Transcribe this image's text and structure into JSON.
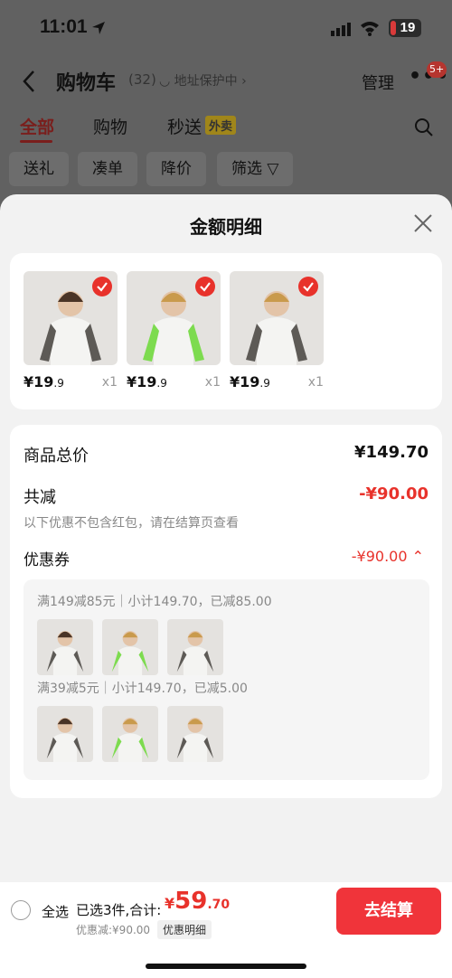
{
  "status_bar": {
    "time": "11:01",
    "battery": "19"
  },
  "nav": {
    "title": "购物车",
    "count": "(32)",
    "address": "◡ 地址保护中 ›",
    "manage": "管理",
    "more": "•••",
    "badge": "5+"
  },
  "tabs": [
    {
      "label": "全部",
      "active": true
    },
    {
      "label": "购物",
      "active": false
    },
    {
      "label": "秒送",
      "tag": "外卖",
      "active": false
    }
  ],
  "chips": [
    "送礼",
    "凑单",
    "降价",
    "筛选 ▽"
  ],
  "sheet": {
    "title": "金额明细",
    "products": [
      {
        "price_main": "¥19",
        "price_dec": ".9",
        "qty": "x1",
        "sleeve_color": "#5d5a56"
      },
      {
        "price_main": "¥19",
        "price_dec": ".9",
        "qty": "x1",
        "sleeve_color": "#7ddb4f"
      },
      {
        "price_main": "¥19",
        "price_dec": ".9",
        "qty": "x1",
        "sleeve_color": "#5d5a56"
      }
    ],
    "summary": {
      "total_label": "商品总价",
      "total_value": "¥149.70",
      "reduce_label": "共减",
      "reduce_value": "-¥90.00",
      "hint": "以下优惠不包含红包，请在结算页查看",
      "coupon_label": "优惠券",
      "coupon_value": "-¥90.00 ⌃"
    },
    "coupons": [
      {
        "text": "满149减85元｜小计149.70，已减85.00"
      },
      {
        "text": "满39减5元｜小计149.70，已减5.00"
      }
    ]
  },
  "bottom": {
    "select_all": "全选",
    "selected_text": "已选3件,合计:",
    "currency": "¥",
    "total_int": "59",
    "total_dec": ".70",
    "discount_text": "优惠减:¥90.00",
    "detail_tag": "优惠明细",
    "checkout": "去结算"
  },
  "colors": {
    "accent_red": "#e8322b",
    "checkout_red": "#f0343a"
  }
}
